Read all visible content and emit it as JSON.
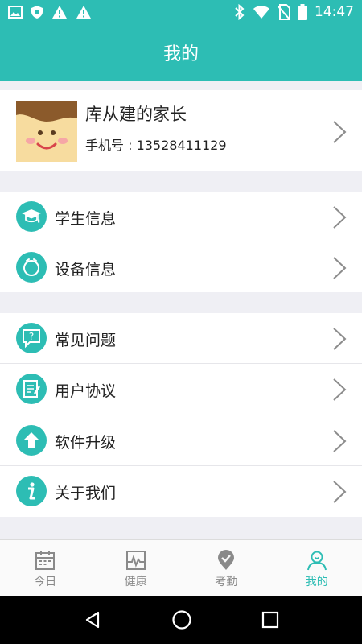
{
  "status_bar": {
    "time": "14:47"
  },
  "header": {
    "title": "我的"
  },
  "profile": {
    "name": "库从建的家长",
    "phone": "手机号 : 13528411129"
  },
  "menu_group_1": [
    {
      "label": "学生信息",
      "icon": "graduation-cap-icon"
    },
    {
      "label": "设备信息",
      "icon": "device-icon"
    }
  ],
  "menu_group_2": [
    {
      "label": "常见问题",
      "icon": "question-icon"
    },
    {
      "label": "用户协议",
      "icon": "document-icon"
    },
    {
      "label": "软件升级",
      "icon": "upgrade-icon"
    },
    {
      "label": "关于我们",
      "icon": "info-icon"
    }
  ],
  "tabs": [
    {
      "label": "今日",
      "icon": "calendar-icon",
      "active": false
    },
    {
      "label": "健康",
      "icon": "health-icon",
      "active": false
    },
    {
      "label": "考勤",
      "icon": "location-icon",
      "active": false
    },
    {
      "label": "我的",
      "icon": "profile-icon",
      "active": true
    }
  ],
  "colors": {
    "accent": "#2dbdb4",
    "inactive": "#8a8a8a",
    "background": "#efeff4"
  }
}
